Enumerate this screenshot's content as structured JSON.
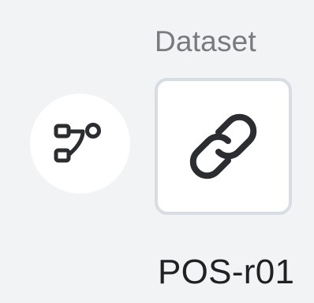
{
  "node": {
    "category_label": "Dataset",
    "name": "POS-r01",
    "icon": "link-icon",
    "pipeline_icon": "workflow-icon"
  },
  "colors": {
    "background": "#f2f3f5",
    "card": "#ffffff",
    "card_border": "#d7dde3",
    "label": "#777a7e",
    "text": "#202124",
    "icon": "#2b2d31"
  }
}
